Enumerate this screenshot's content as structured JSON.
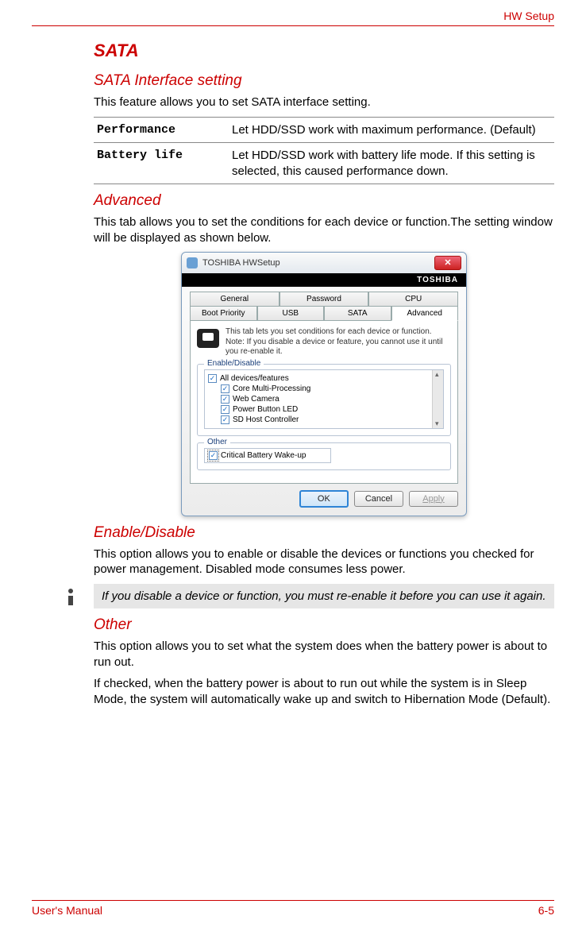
{
  "header": {
    "section": "HW Setup"
  },
  "sata": {
    "heading": "SATA",
    "subheading": "SATA Interface setting",
    "desc": "This feature allows you to set SATA interface setting.",
    "options": [
      {
        "key": "Performance",
        "desc": "Let HDD/SSD work with maximum performance. (Default)"
      },
      {
        "key": "Battery life",
        "desc": "Let HDD/SSD work with battery life mode. If this setting is selected, this caused performance down."
      }
    ]
  },
  "advanced": {
    "heading": "Advanced",
    "desc": "This tab allows you to set the conditions for each device or function.The setting window will be displayed as shown below."
  },
  "dialog": {
    "title": "TOSHIBA HWSetup",
    "brand": "TOSHIBA",
    "tabs_row1": [
      "General",
      "Password",
      "CPU"
    ],
    "tabs_row2": [
      "Boot Priority",
      "USB",
      "SATA",
      "Advanced"
    ],
    "active_tab": "Advanced",
    "note": "This tab lets you set conditions for each device or function.\nNote: If you disable a device or feature, you cannot use it until you re-enable it.",
    "group1_legend": "Enable/Disable",
    "checks": [
      {
        "label": "All devices/features",
        "indent": false,
        "checked": true
      },
      {
        "label": "Core Multi-Processing",
        "indent": true,
        "checked": true
      },
      {
        "label": "Web Camera",
        "indent": true,
        "checked": true
      },
      {
        "label": "Power Button LED",
        "indent": true,
        "checked": true
      },
      {
        "label": "SD Host Controller",
        "indent": true,
        "checked": true
      }
    ],
    "group2_legend": "Other",
    "other_check": {
      "label": "Critical Battery Wake-up",
      "checked": true
    },
    "buttons": {
      "ok": "OK",
      "cancel": "Cancel",
      "apply": "Apply"
    }
  },
  "enable_disable": {
    "heading": "Enable/Disable",
    "desc": "This option allows you to enable or disable the devices or functions you checked for power management. Disabled mode consumes less power.",
    "info": "If you disable a device or function, you must re-enable it before you can use it again."
  },
  "other_section": {
    "heading": "Other",
    "para1": "This option allows you to set what the system does when the battery power is about to run out.",
    "para2": "If checked, when the battery power is about to run out while the system is in Sleep Mode, the system will automatically wake up and switch to Hibernation Mode (Default)."
  },
  "footer": {
    "left": "User's Manual",
    "right": "6-5"
  }
}
